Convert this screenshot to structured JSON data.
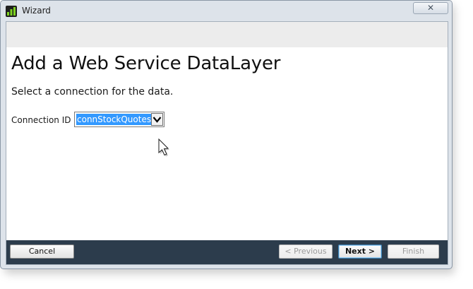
{
  "window": {
    "title": "Wizard",
    "close_glyph": "✕",
    "icon": "bar-chart-icon"
  },
  "wizard": {
    "title": "Add a Web Service DataLayer",
    "subtitle": "Select a connection for the data."
  },
  "connection": {
    "label": "Connection ID",
    "value": "connStockQuotes",
    "arrow_icon": "chevron-down-icon"
  },
  "buttons": {
    "cancel": "Cancel",
    "previous": "< Previous",
    "next": "Next >",
    "finish": "Finish"
  },
  "colors": {
    "selection": "#3399ff",
    "footer": "#2c3c4c",
    "icon_green": "#2e8b2e"
  }
}
